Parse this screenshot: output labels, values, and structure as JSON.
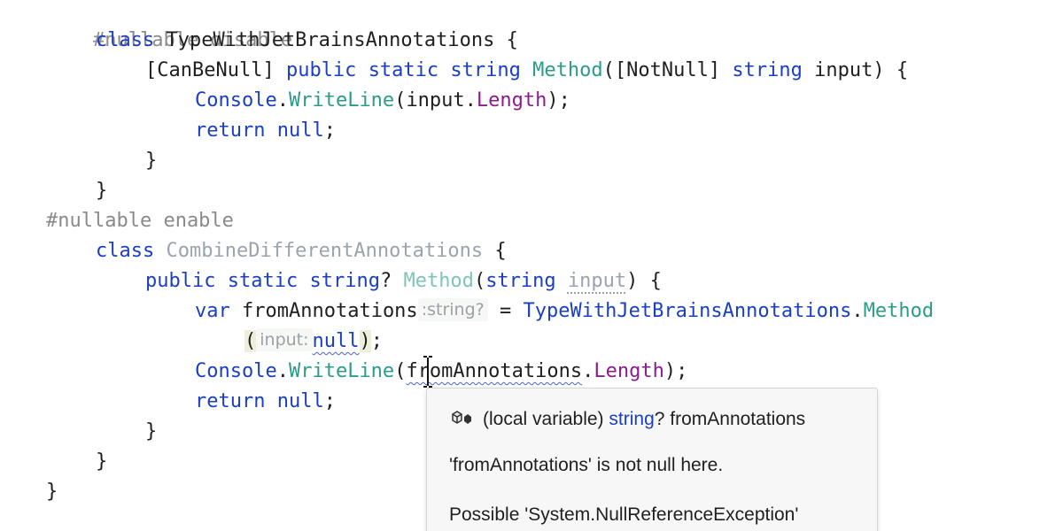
{
  "code": {
    "l1": {
      "directive": "#nullable disable"
    },
    "l2": {
      "kw_class": "class",
      "name": "TypeWithJetBrainsAnnotations",
      "brace": "{"
    },
    "l3": {
      "attr1": "[CanBeNull]",
      "kw_public": "public",
      "kw_static": "static",
      "kw_string": "string",
      "method": "Method",
      "open": "(",
      "attr2": "[NotNull]",
      "kw_string2": "string",
      "param": "input",
      "close": ") {"
    },
    "l4": {
      "console": "Console",
      "dot": ".",
      "writeline": "WriteLine",
      "open": "(",
      "input": "input",
      "dot2": ".",
      "length": "Length",
      "close": ");"
    },
    "l5": {
      "kw_return": "return",
      "kw_null": "null",
      "semi": ";"
    },
    "l6": {
      "brace": "}"
    },
    "l7": {
      "brace": "}"
    },
    "l8": {
      "directive": "#nullable enable"
    },
    "l9": {
      "kw_class": "class",
      "name": "CombineDifferentAnnotations",
      "brace": "{"
    },
    "l10": {
      "kw_public": "public",
      "kw_static": "static",
      "kw_string": "string",
      "q": "?",
      "method": "Method",
      "open": "(",
      "kw_string2": "string",
      "param": "input",
      "close": ") {"
    },
    "l11": {
      "kw_var": "var",
      "name": "fromAnnotations",
      "hint": ":string?",
      "eq": "=",
      "type": "TypeWithJetBrainsAnnotations",
      "dot": ".",
      "method": "Method"
    },
    "l12": {
      "open": "(",
      "hint": "input:",
      "kw_null": "null",
      "close": ")",
      "semi": ";"
    },
    "l13": {
      "console": "Console",
      "dot": ".",
      "writeline": "WriteLine",
      "open": "(",
      "var": "fromAnnotations",
      "dot2": ".",
      "length": "Length",
      "close": ");"
    },
    "l14": {
      "kw_return": "return",
      "kw_null": "null",
      "semi": ";"
    },
    "l15": {
      "brace": "}"
    },
    "l16": {
      "brace": "}"
    },
    "l17": {
      "brace": "}"
    }
  },
  "tooltip": {
    "icon": "local-variable-icon",
    "sig_prefix": "(local variable) ",
    "sig_type": "string",
    "sig_suffix": "? fromAnnotations",
    "note": "'fromAnnotations' is not null here.",
    "warning": "Possible 'System.NullReferenceException'"
  },
  "colors": {
    "keyword": "#1a3fc2",
    "method": "#2b9c8a",
    "property": "#8b1b8f",
    "directive": "#8a8a8a",
    "squiggle": "#4a63d8"
  }
}
